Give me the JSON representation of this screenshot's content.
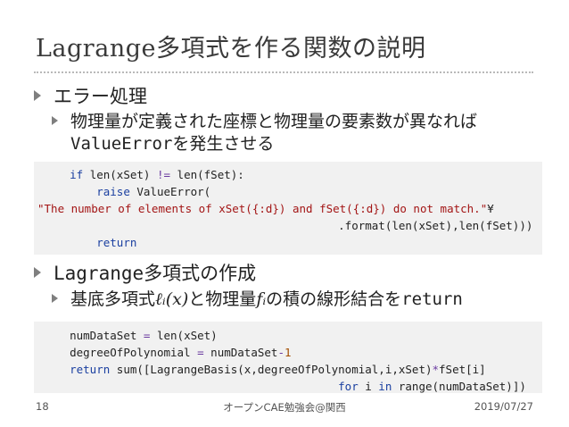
{
  "title": "Lagrange多項式を作る関数の説明",
  "section1": {
    "heading": "エラー処理",
    "sub_line1": "物理量が定義された座標と物理量の要素数が異なれば",
    "sub_line2_code": "ValueError",
    "sub_line2_rest": "を発生させる"
  },
  "code1": {
    "line1": {
      "indent": "    ",
      "kw_if": "if",
      "a": " len(xSet) ",
      "op": "!=",
      "b": " len(fSet):"
    },
    "line2": {
      "indent": "        ",
      "kw": "raise",
      "rest": " ValueError("
    },
    "line3": {
      "str": "\"The number of elements of xSet({:d}) and fSet({:d}) do not match.\"",
      "tail": "¥"
    },
    "line4": {
      "indent": "                                            ",
      "rest": ".format(len(xSet),len(fSet)))"
    },
    "line5": {
      "indent": "        ",
      "kw": "return"
    }
  },
  "section2": {
    "heading_code": "Lagrange",
    "heading_rest": "多項式の作成",
    "sub_prefix": "基底多項式",
    "sub_math1": "ℓᵢ(x)",
    "sub_mid": "と物理量",
    "sub_math2": "fᵢ",
    "sub_suffix": "の積の線形結合を",
    "sub_code": "return"
  },
  "code2": {
    "line1": {
      "indent": "    ",
      "a": "numDataSet ",
      "op": "=",
      "b": " len(xSet)"
    },
    "line2": {
      "indent": "    ",
      "a": "degreeOfPolynomial ",
      "op": "=",
      "b": " numDataSet",
      "op2": "-",
      "num": "1"
    },
    "line3": {
      "indent": "    ",
      "kw": "return",
      "a": " sum([LagrangeBasis(x,degreeOfPolynomial,i,xSet)",
      "op": "*",
      "b": "fSet[i]"
    },
    "line4": {
      "indent": "                                            ",
      "kw_for": "for",
      "a": " i ",
      "kw_in": "in",
      "b": " range(numDataSet)])"
    }
  },
  "footer": {
    "page": "18",
    "center": "オープンCAE勉強会@関西",
    "date": "2019/07/27"
  }
}
